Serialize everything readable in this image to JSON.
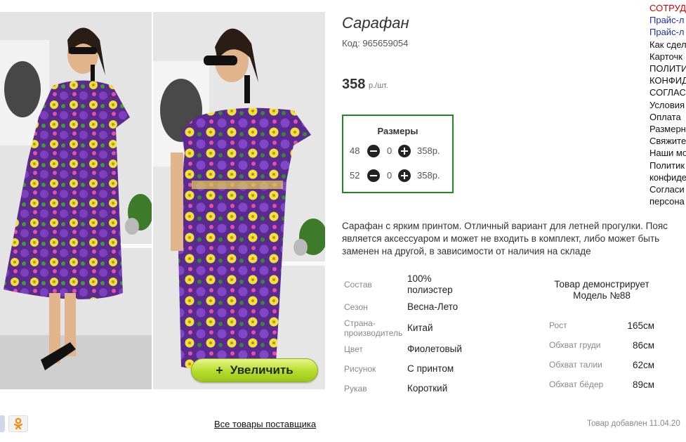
{
  "product": {
    "title": "Сарафан",
    "code": "Код: 965659054",
    "price": "358",
    "price_unit": "р./шт.",
    "description": "Сарафан с ярким принтом. Отличный вариант для летней прогулки. Пояс является аксессуаром и может не входить в комплект, либо может быть заменен на другой, в зависимости от наличия на складе"
  },
  "sizes": {
    "title": "Размеры",
    "rows": [
      {
        "size": "48",
        "qty": "0",
        "price": "358р."
      },
      {
        "size": "52",
        "qty": "0",
        "price": "358р."
      }
    ]
  },
  "gallery": {
    "zoom_label": "Увеличить",
    "zoom_plus": "+"
  },
  "attributes": [
    {
      "label": "Состав",
      "value": "100% полиэстер"
    },
    {
      "label": "Сезон",
      "value": "Весна-Лето"
    },
    {
      "label": "Страна-производитель",
      "value": "Китай"
    },
    {
      "label": "Цвет",
      "value": "Фиолетовый"
    },
    {
      "label": "Рисунок",
      "value": "С принтом"
    },
    {
      "label": "Рукав",
      "value": "Короткий"
    }
  ],
  "model": {
    "title": "Товар демонстрирует Модель №88",
    "params": [
      {
        "label": "Рост",
        "value": "165см"
      },
      {
        "label": "Обхват груди",
        "value": "86см"
      },
      {
        "label": "Обхват талии",
        "value": "62см"
      },
      {
        "label": "Обхват бёдер",
        "value": "89см"
      }
    ]
  },
  "side_links": [
    {
      "text": "СОТРУД",
      "tone": "red"
    },
    {
      "text": "Прайс-л",
      "tone": "blue"
    },
    {
      "text": "Прайс-л",
      "tone": "blue"
    },
    {
      "text": "Как сдел",
      "tone": "dark"
    },
    {
      "text": "Карточк",
      "tone": "dark"
    },
    {
      "text": "ПОЛИТИ",
      "tone": "dark"
    },
    {
      "text": "КОНФИД",
      "tone": "dark"
    },
    {
      "text": "СОГЛАС",
      "tone": "dark"
    },
    {
      "text": "Условия",
      "tone": "dark"
    },
    {
      "text": "Оплата",
      "tone": "dark"
    },
    {
      "text": "Размерн",
      "tone": "dark"
    },
    {
      "text": "Свяжите",
      "tone": "dark"
    },
    {
      "text": "Наши мо",
      "tone": "dark"
    },
    {
      "text": "Политик",
      "tone": "dark"
    },
    {
      "text": "конфиде",
      "tone": "dark"
    },
    {
      "text": "Согласи",
      "tone": "dark"
    },
    {
      "text": "персона",
      "tone": "dark"
    }
  ],
  "footer": {
    "all_goods": "Все товары поставщика",
    "added": "Товар добавлен 11.04.20"
  },
  "colors": {
    "sizes_border": "#1f8a1f",
    "zoom_button": "#b6dc2a",
    "link_red": "#d40000",
    "link_blue": "#1a31b8"
  }
}
